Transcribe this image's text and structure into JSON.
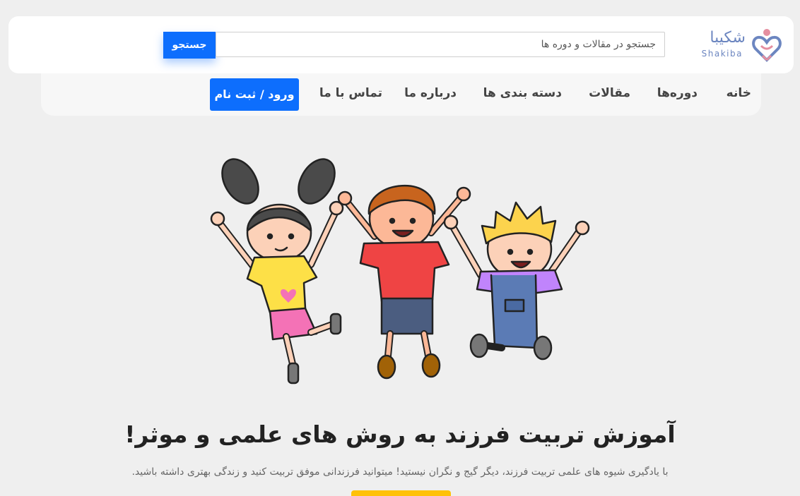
{
  "brand": {
    "name": "شکیبا",
    "latin": "Shakiba",
    "logo_icon": "heart-hands-icon",
    "color": "#6c86c0",
    "accent": "#e58fa0"
  },
  "search": {
    "placeholder": "جستجو در مقالات و دوره ها",
    "button_label": "جستجو"
  },
  "nav": {
    "items": [
      {
        "label": "خانه"
      },
      {
        "label": "دوره‌ها"
      },
      {
        "label": "مقالات"
      },
      {
        "label": "دسته بندی ها"
      },
      {
        "label": "درباره ما"
      },
      {
        "label": "تماس با ما"
      }
    ],
    "login_label": "ورود / ثبت نام"
  },
  "hero": {
    "image": "jumping-kids-illustration",
    "title": "آموزش تربیت فرزند به روش های علمی و موثر!",
    "subtitle": "با یادگیری شیوه های علمی تربیت فرزند، دیگر گیج و نگران نیستید! میتوانید فرزندانی موفق تربیت کنید و زندگی بهتری داشته باشید."
  },
  "colors": {
    "primary": "#0d6efd",
    "page_bg": "#efefef",
    "cta": "#ffc107"
  }
}
